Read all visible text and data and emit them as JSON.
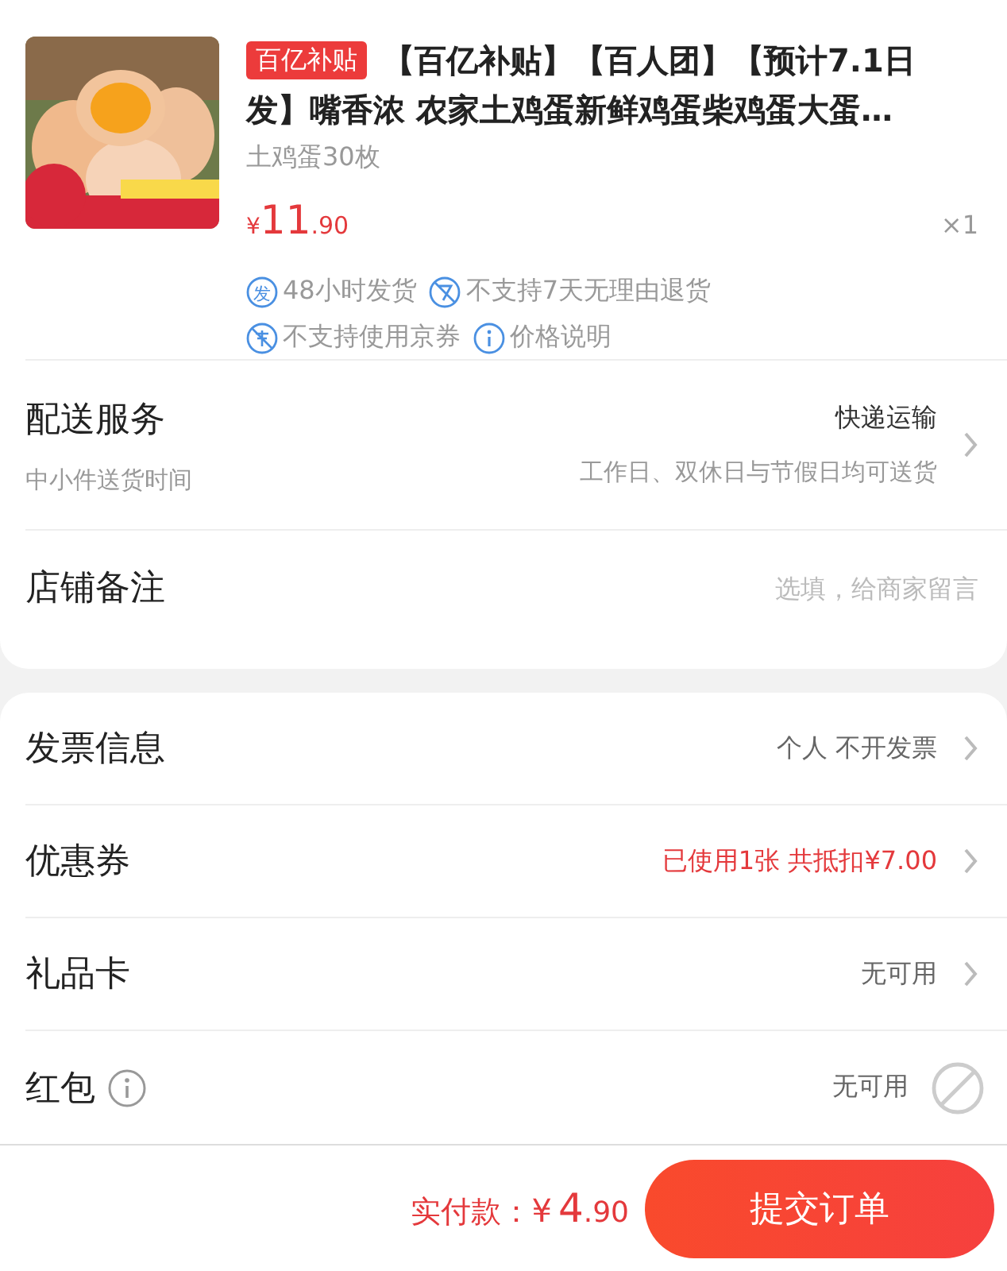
{
  "product": {
    "badge": "百亿补贴",
    "title": "【百亿补贴】【百人团】【预计7.1日发】嘴香浓 农家土鸡蛋新鲜鸡蛋柴鸡蛋大蛋…",
    "spec": "土鸡蛋30枚",
    "price": {
      "currency": "¥",
      "integer": "11",
      "decimal": ".90"
    },
    "quantity": "×1",
    "services": [
      {
        "kind": "ship",
        "icon_text": "发",
        "text": "48小时发货"
      },
      {
        "kind": "no-return",
        "text": "不支持7天无理由退货"
      },
      {
        "kind": "no-coupon",
        "text": "不支持使用京券"
      },
      {
        "kind": "info",
        "text": "价格说明"
      }
    ]
  },
  "delivery": {
    "label": "配送服务",
    "value": "快递运输",
    "sub_label": "中小件送货时间",
    "sub_value": "工作日、双休日与节假日均可送货"
  },
  "note": {
    "label": "店铺备注",
    "placeholder": "选填，给商家留言"
  },
  "rows": [
    {
      "label": "发票信息",
      "value": "个人 不开发票",
      "kind": "link",
      "highlight": false,
      "info": false
    },
    {
      "label": "优惠券",
      "value": "已使用1张 共抵扣¥7.00",
      "kind": "link",
      "highlight": true,
      "info": false
    },
    {
      "label": "礼品卡",
      "value": "无可用",
      "kind": "link",
      "highlight": false,
      "info": false
    },
    {
      "label": "红包",
      "value": "无可用",
      "kind": "disabled",
      "highlight": false,
      "info": true
    }
  ],
  "footer": {
    "label": "实付款：",
    "currency": "¥",
    "integer": "4",
    "decimal": ".90",
    "button": "提交订单"
  }
}
